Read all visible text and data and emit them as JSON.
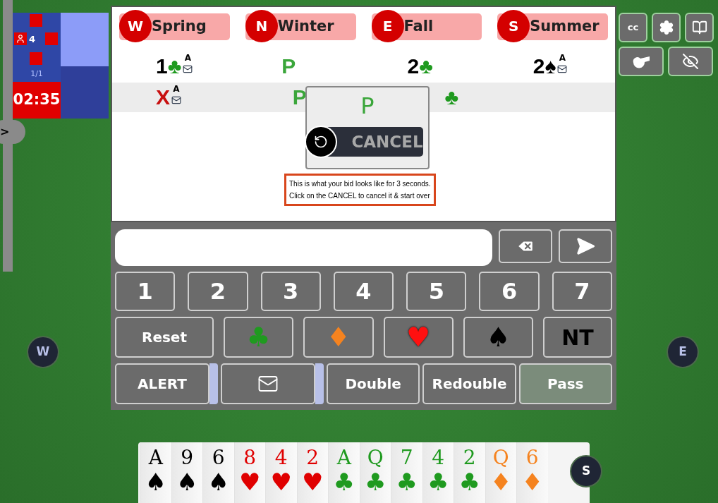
{
  "clock": {
    "players": "4",
    "board": "1/1",
    "timer": "02:35"
  },
  "side_tab": ">",
  "players": [
    {
      "seat": "W",
      "name": "Spring"
    },
    {
      "seat": "N",
      "name": "Winter"
    },
    {
      "seat": "E",
      "name": "Fall"
    },
    {
      "seat": "S",
      "name": "Summer"
    }
  ],
  "auction": [
    {
      "cells": [
        {
          "level": "1",
          "suit": "♣",
          "kind": "club",
          "alert": "A"
        },
        {
          "level": "P",
          "kind": "pass"
        },
        {
          "level": "2",
          "suit": "♣",
          "kind": "club"
        },
        {
          "level": "2",
          "suit": "♠",
          "kind": "spade",
          "alert": "A"
        }
      ]
    },
    {
      "cells": [
        {
          "level": "X",
          "kind": "double",
          "alert": "A"
        },
        {
          "level": "P",
          "kind": "pass"
        },
        {
          "suit": "♣",
          "kind": "club"
        }
      ]
    }
  ],
  "popup": {
    "bid": "P",
    "cancel": "CANCEL"
  },
  "hint": [
    "This is what your bid looks like for 3 seconds.",
    "Click on the CANCEL to cancel it & start over"
  ],
  "toolbar": {
    "cc": "cc"
  },
  "keypad": {
    "levels": [
      "1",
      "2",
      "3",
      "4",
      "5",
      "6",
      "7"
    ],
    "reset": "Reset",
    "suits": [
      {
        "symbol": "♣",
        "kind": "club"
      },
      {
        "symbol": "♦",
        "kind": "diamond"
      },
      {
        "symbol": "♥",
        "kind": "heart"
      },
      {
        "symbol": "♠",
        "kind": "spade"
      }
    ],
    "nt": "NT",
    "actions": [
      {
        "kind": "alert",
        "label": "ALERT",
        "selected": false
      },
      {
        "kind": "message",
        "selected": false
      },
      {
        "kind": "plain",
        "label": "Double",
        "selected": false
      },
      {
        "kind": "plain",
        "label": "Redouble",
        "selected": false
      },
      {
        "kind": "plain",
        "label": "Pass",
        "selected": true
      }
    ]
  },
  "seats": {
    "west": "W",
    "east": "E",
    "south": "S"
  },
  "hand": [
    {
      "rank": "A",
      "suit": "♠",
      "kind": "spade"
    },
    {
      "rank": "9",
      "suit": "♠",
      "kind": "spade"
    },
    {
      "rank": "6",
      "suit": "♠",
      "kind": "spade"
    },
    {
      "rank": "8",
      "suit": "♥",
      "kind": "heart"
    },
    {
      "rank": "4",
      "suit": "♥",
      "kind": "heart"
    },
    {
      "rank": "2",
      "suit": "♥",
      "kind": "heart"
    },
    {
      "rank": "A",
      "suit": "♣",
      "kind": "club"
    },
    {
      "rank": "Q",
      "suit": "♣",
      "kind": "club"
    },
    {
      "rank": "7",
      "suit": "♣",
      "kind": "club"
    },
    {
      "rank": "4",
      "suit": "♣",
      "kind": "club"
    },
    {
      "rank": "2",
      "suit": "♣",
      "kind": "club"
    },
    {
      "rank": "Q",
      "suit": "♦",
      "kind": "diamond"
    },
    {
      "rank": "6",
      "suit": "♦",
      "kind": "diamond"
    }
  ]
}
